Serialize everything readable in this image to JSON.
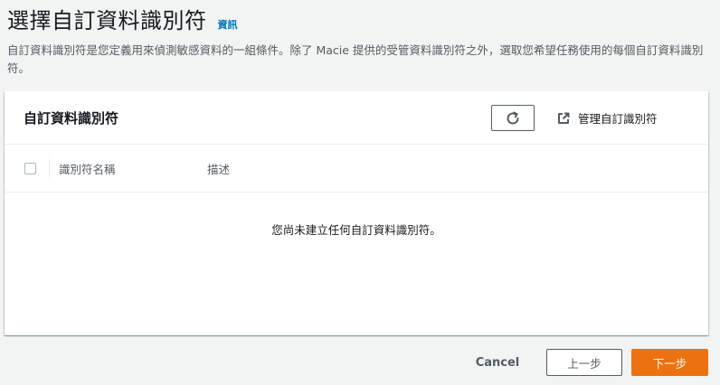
{
  "page": {
    "title": "選擇自訂資料識別符",
    "info_link": "資訊",
    "description": "自訂資料識別符是您定義用來偵測敏感資料的一組條件。除了 Macie 提供的受管資料識別符之外，選取您希望任務使用的每個自訂資料識別符。"
  },
  "panel": {
    "title": "自訂資料識別符",
    "refresh_icon": "refresh-icon",
    "manage_icon": "external-link-icon",
    "manage_link": "管理自訂識別符",
    "table": {
      "columns": [
        "識別符名稱",
        "描述"
      ],
      "rows": [],
      "empty_message": "您尚未建立任何自訂資料識別符。"
    }
  },
  "footer": {
    "cancel": "Cancel",
    "previous": "上一步",
    "next": "下一步"
  },
  "colors": {
    "primary_button": "#ec7211",
    "link": "#0073bb",
    "background": "#f2f3f3"
  }
}
